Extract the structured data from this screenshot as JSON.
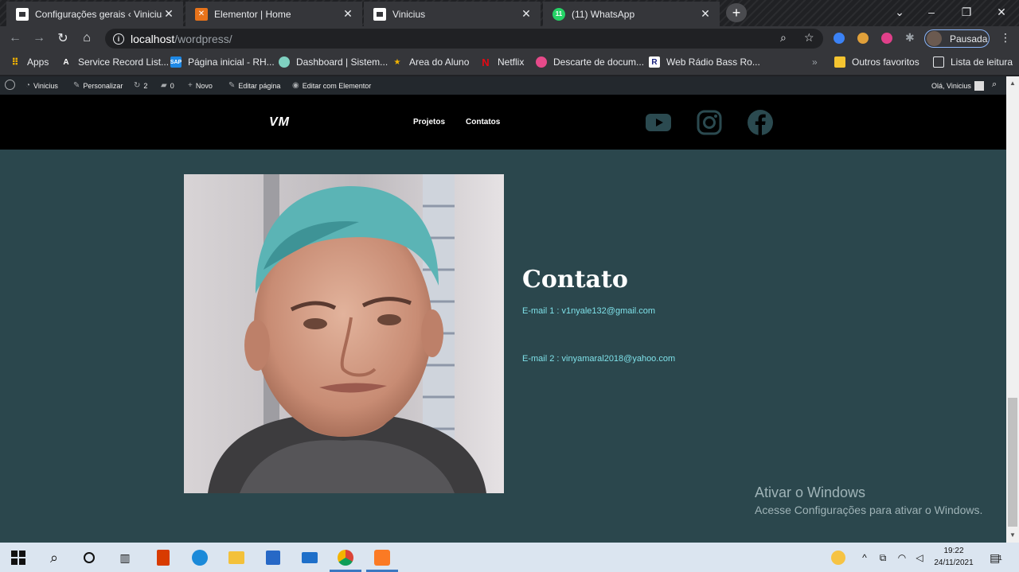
{
  "tabs": [
    {
      "title": "Configurações gerais ‹ Vinicius —",
      "favicon_color": "#ffffff"
    },
    {
      "title": "Elementor | Home",
      "favicon_color": "#e8731a"
    },
    {
      "title": "Vinicius",
      "favicon_color": "#ffffff"
    },
    {
      "title": "(11) WhatsApp",
      "favicon_color": "#25d366",
      "badge": "11"
    }
  ],
  "window_controls": {
    "minimize": "–",
    "restore": "❐",
    "close": "✕"
  },
  "address_bar": {
    "host": "localhost",
    "path": "/wordpress/"
  },
  "profile": {
    "label": "Pausada"
  },
  "bookmarks": {
    "items": [
      {
        "label": "Apps",
        "color": "#f4b400"
      },
      {
        "label": "Service Record List...",
        "color": "#ffffff"
      },
      {
        "label": "Página inicial - RH...",
        "color": "#1e88e5"
      },
      {
        "label": "Dashboard | Sistem...",
        "color": "#7fd0c0"
      },
      {
        "label": "Area do Aluno",
        "color": "#f4b400"
      },
      {
        "label": "Netflix",
        "color": "#e50914",
        "glyph": "N"
      },
      {
        "label": "Descarte de docum...",
        "color": "#e64a8a"
      },
      {
        "label": "Web Rádio Bass Ro...",
        "color": "#ffffff",
        "glyph": "R"
      }
    ],
    "more": "»",
    "other": "Outros favoritos",
    "reading_list": "Lista de leitura"
  },
  "wp_admin_bar": {
    "site": "Vinicius",
    "customize": "Personalizar",
    "updates": "2",
    "comments": "0",
    "new": "Novo",
    "edit_page": "Editar página",
    "edit_elementor": "Editar com Elementor",
    "greeting": "Olá, Vinicius"
  },
  "site": {
    "logo": "VM",
    "nav": [
      {
        "label": "Projetos"
      },
      {
        "label": "Contatos"
      }
    ],
    "social": [
      "youtube-icon",
      "instagram-icon",
      "facebook-icon"
    ]
  },
  "contact": {
    "title": "Contato",
    "email1": "E-mail 1 : v1nyale132@gmail.com",
    "email2": "E-mail 2 : vinyamaral2018@yahoo.com"
  },
  "windows_activation": {
    "title": "Ativar o Windows",
    "subtitle": "Acesse Configurações para ativar o Windows."
  },
  "taskbar": {
    "time": "19:22",
    "date": "24/11/2021",
    "notifications": "1"
  }
}
